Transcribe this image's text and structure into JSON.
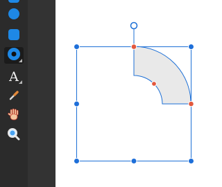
{
  "toolbar": {
    "tools": [
      {
        "name": "rectangle-tool",
        "icon": "rounded-square-icon",
        "active": false
      },
      {
        "name": "ellipse-tool",
        "icon": "circle-icon",
        "active": false
      },
      {
        "name": "rounded-rectangle-tool",
        "icon": "rounded-square-icon",
        "active": false
      },
      {
        "name": "shape-tool",
        "icon": "ring-icon",
        "active": true
      },
      {
        "name": "text-tool",
        "icon": "text-icon",
        "label": "A",
        "active": false
      },
      {
        "name": "color-picker-tool",
        "icon": "eyedropper-icon",
        "active": false
      },
      {
        "name": "pan-tool",
        "icon": "hand-icon",
        "active": false
      },
      {
        "name": "zoom-tool",
        "icon": "magnifier-icon",
        "active": false
      }
    ]
  },
  "colors": {
    "toolbar_bg": "#2b2b2b",
    "gutter_bg": "#333333",
    "tool_blue": "#1e88e5",
    "selection_blue": "#1c6fd6",
    "handle_orange": "#e2583e",
    "shape_fill": "#e9e9e9",
    "shape_stroke": "#1c6fd6"
  },
  "canvas": {
    "selected_shape": "quarter-ring"
  }
}
